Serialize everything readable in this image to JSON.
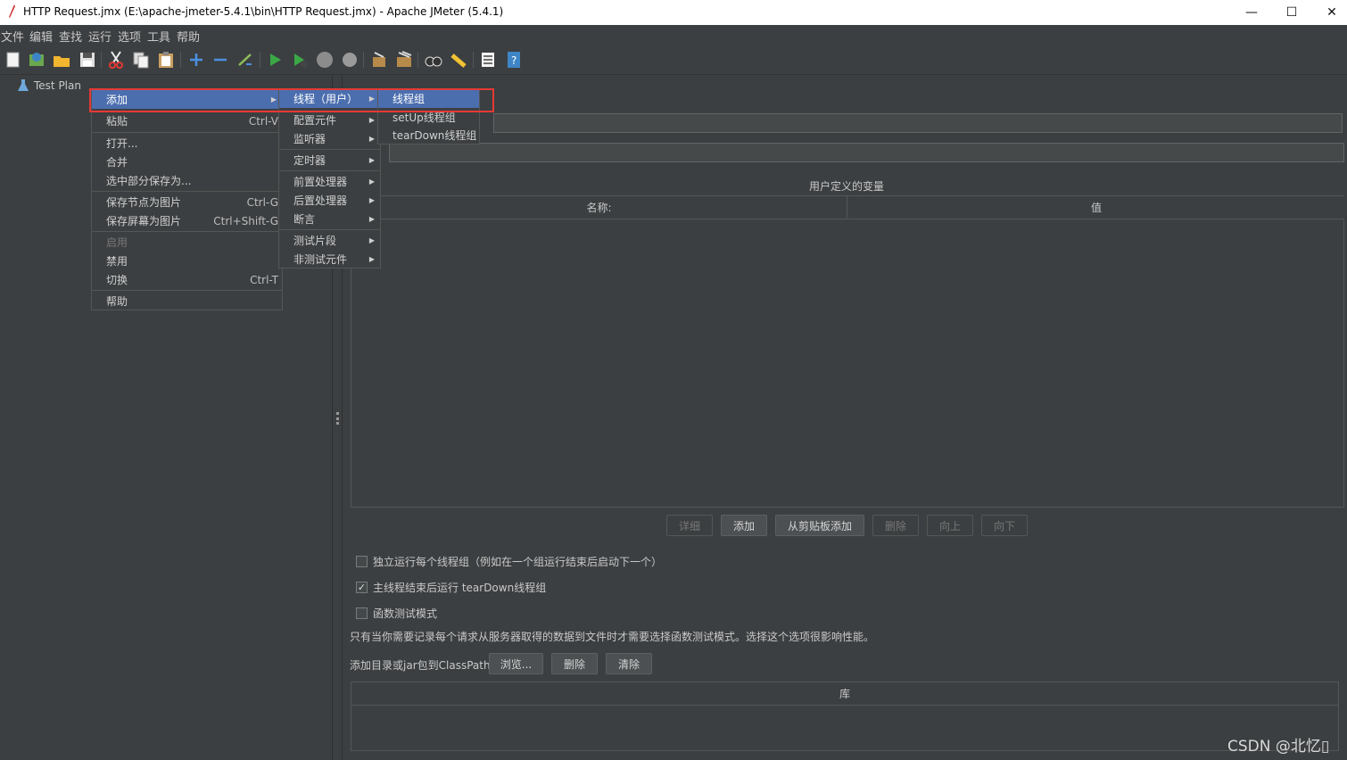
{
  "window": {
    "title": "HTTP Request.jmx (E:\\apache-jmeter-5.4.1\\bin\\HTTP Request.jmx) - Apache JMeter (5.4.1)",
    "minimize": "—",
    "maximize": "☐",
    "close": "✕"
  },
  "menubar": [
    "文件",
    "编辑",
    "查找",
    "运行",
    "选项",
    "工具",
    "帮助"
  ],
  "toolbar_icons": [
    "new-icon",
    "templates-icon",
    "open-icon",
    "save-icon",
    "cut-icon",
    "copy-icon",
    "paste-icon",
    "expand-icon",
    "collapse-icon",
    "toggle-icon",
    "start-icon",
    "start-no-pause-icon",
    "stop-icon",
    "shutdown-icon",
    "clear-icon",
    "clear-all-icon",
    "search-icon",
    "reset-search-icon",
    "function-helper-icon",
    "help-icon"
  ],
  "tree": {
    "root": "Test Plan"
  },
  "context_menu": {
    "items": [
      {
        "label": "添加",
        "arrow": "▶"
      },
      {
        "label": "粘贴",
        "shortcut": "Ctrl-V"
      },
      {
        "label": "打开..."
      },
      {
        "label": "合并"
      },
      {
        "label": "选中部分保存为..."
      },
      {
        "label": "保存节点为图片",
        "shortcut": "Ctrl-G"
      },
      {
        "label": "保存屏幕为图片",
        "shortcut": "Ctrl+Shift-G"
      },
      {
        "label": "启用"
      },
      {
        "label": "禁用"
      },
      {
        "label": "切换",
        "shortcut": "Ctrl-T"
      },
      {
        "label": "帮助"
      }
    ]
  },
  "add_submenu": {
    "items": [
      "线程（用户）",
      "配置元件",
      "监听器",
      "定时器",
      "前置处理器",
      "后置处理器",
      "断言",
      "测试片段",
      "非测试元件"
    ],
    "arrow": "▶"
  },
  "thread_submenu": {
    "items": [
      "线程组",
      "setUp线程组",
      "tearDown线程组"
    ]
  },
  "panel": {
    "vars_title": "用户定义的变量",
    "col_name": "名称:",
    "col_value": "值",
    "buttons": [
      "详细",
      "添加",
      "从剪贴板添加",
      "删除",
      "向上",
      "向下"
    ],
    "checkboxes": [
      {
        "label": "独立运行每个线程组（例如在一个组运行结束后启动下一个）",
        "checked": false
      },
      {
        "label": "主线程结束后运行 tearDown线程组",
        "checked": true
      },
      {
        "label": "函数测试模式",
        "checked": false
      }
    ],
    "check_mark": "✓",
    "note": "只有当你需要记录每个请求从服务器取得的数据到文件时才需要选择函数测试模式。选择这个选项很影响性能。",
    "classpath_label": "添加目录或jar包到ClassPath",
    "classpath_buttons": [
      "浏览...",
      "删除",
      "清除"
    ],
    "lib_col": "库"
  },
  "watermark": "CSDN @北忆▯"
}
